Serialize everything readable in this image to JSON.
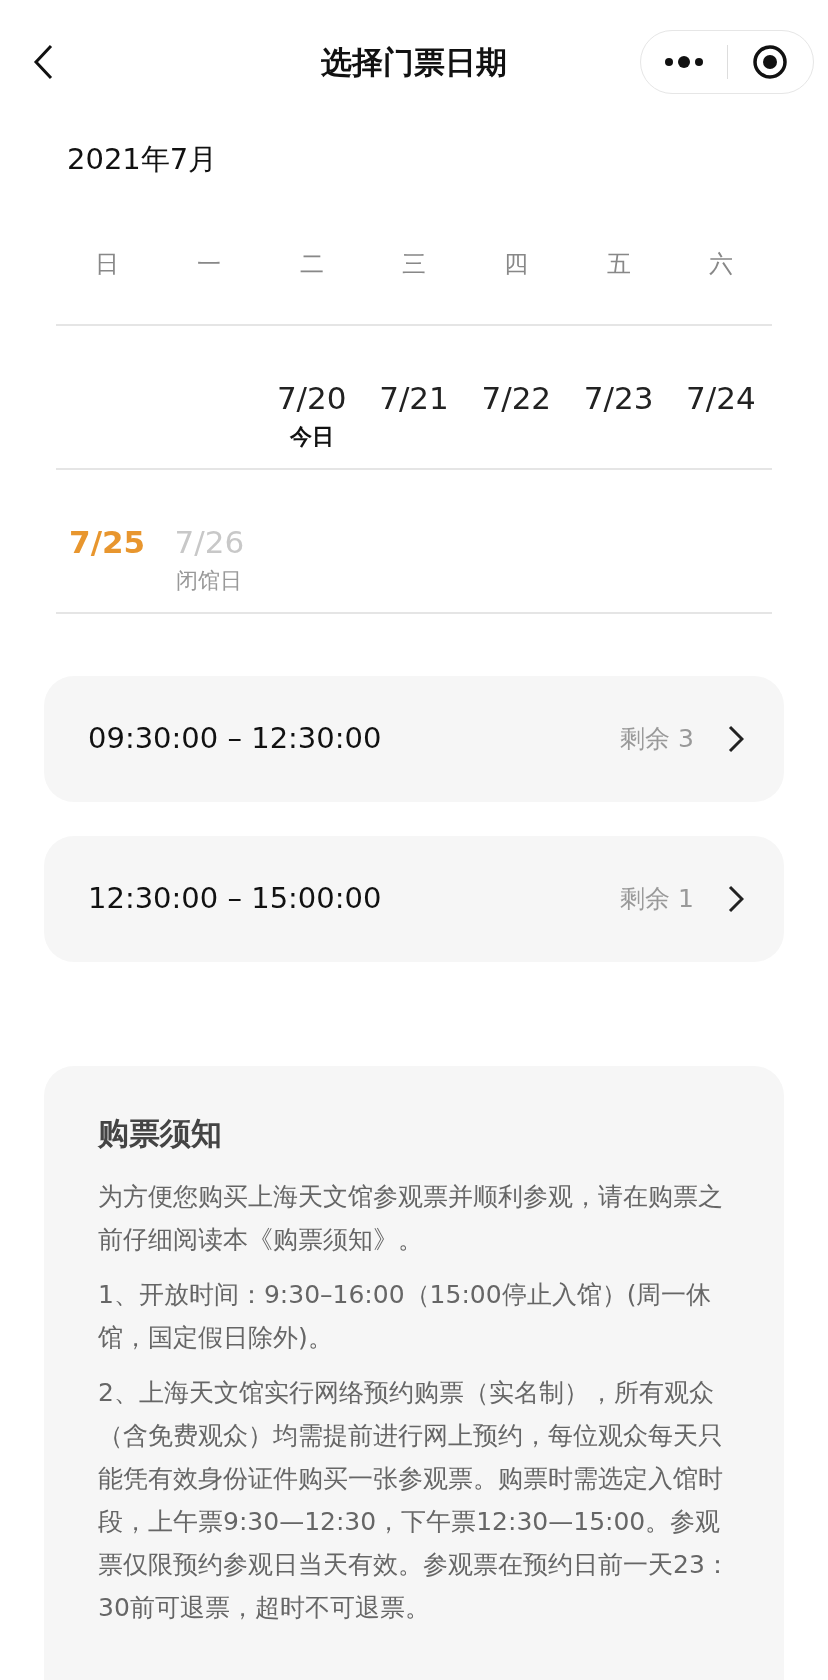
{
  "header": {
    "title": "选择门票日期"
  },
  "calendar": {
    "month": "2021年7月",
    "weekdays": [
      "日",
      "一",
      "二",
      "三",
      "四",
      "五",
      "六"
    ],
    "weeks": [
      [
        {
          "kind": "blank"
        },
        {
          "kind": "blank"
        },
        {
          "kind": "day",
          "date": "7/20",
          "note": "今日",
          "selected": false,
          "disabled": false
        },
        {
          "kind": "day",
          "date": "7/21",
          "selected": false,
          "disabled": false
        },
        {
          "kind": "day",
          "date": "7/22",
          "selected": false,
          "disabled": false
        },
        {
          "kind": "day",
          "date": "7/23",
          "selected": false,
          "disabled": false
        },
        {
          "kind": "day",
          "date": "7/24",
          "selected": false,
          "disabled": false
        }
      ],
      [
        {
          "kind": "day",
          "date": "7/25",
          "selected": true,
          "disabled": false
        },
        {
          "kind": "day",
          "date": "7/26",
          "note": "闭馆日",
          "selected": false,
          "disabled": true
        }
      ]
    ]
  },
  "time_slots": [
    {
      "time": "09:30:00 – 12:30:00",
      "remaining": "剩余 3"
    },
    {
      "time": "12:30:00 – 15:00:00",
      "remaining": "剩余 1"
    }
  ],
  "notice": {
    "title": "购票须知",
    "paragraphs": [
      "为方便您购买上海天文馆参观票并顺利参观，请在购票之前仔细阅读本《购票须知》。",
      "1、开放时间：9:30–16:00（15:00停止入馆）(周一休馆，国定假日除外)。",
      "2、上海天文馆实行网络预约购票（实名制），所有观众（含免费观众）均需提前进行网上预约，每位观众每天只能凭有效身份证件购买一张参观票。购票时需选定入馆时段，上午票9:30—12:30，下午票12:30—15:00。参观票仅限预约参观日当天有效。参观票在预约日前一天23：30前可退票，超时不可退票。"
    ]
  }
}
